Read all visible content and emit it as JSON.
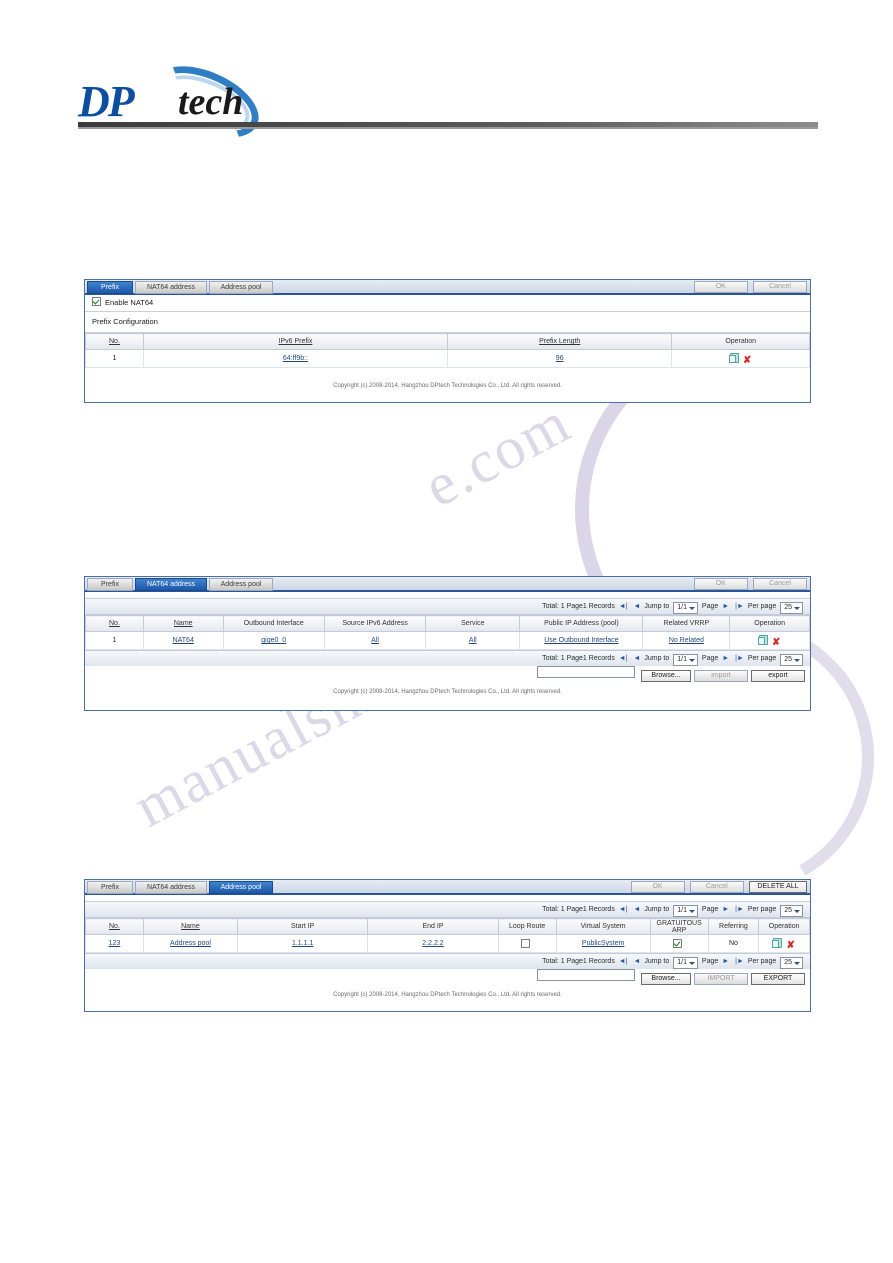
{
  "logo": {
    "brand_left": "DP",
    "brand_right": "tech"
  },
  "watermark": {
    "line1": "e.com",
    "line2": "manualshive"
  },
  "footer_text": "Copyright (c) 2008-2014, Hangzhou DPtech Technologies Co., Ltd. All rights reserved.",
  "tabs": {
    "prefix": "Prefix",
    "nat64_address": "NAT64 address",
    "address_pool": "Address pool"
  },
  "buttons": {
    "ok": "OK",
    "cancel": "Cancel",
    "delete_all": "DELETE ALL",
    "browse": "Browse...",
    "import_lower": "import",
    "export_lower": "export",
    "import_upper": "IMPORT",
    "export_upper": "EXPORT"
  },
  "pagination": {
    "total": "Total: 1 Page1 Records",
    "jump_label": "Jump to",
    "page_value": "1/1",
    "page_label": "Page",
    "per_page_label": "Per page",
    "per_page_value": "25",
    "first_icon": "first-page-icon",
    "prev_icon": "prev-page-icon",
    "next_icon": "next-page-icon",
    "last_icon": "last-page-icon"
  },
  "panel_prefix": {
    "enable_label": "Enable NAT64",
    "enable_checked": true,
    "section_title": "Prefix Configuration",
    "columns": [
      "No.",
      "IPv6 Prefix",
      "Prefix Length",
      "Operation"
    ],
    "rows": [
      {
        "no": "1",
        "ipv6_prefix": "64:ff9b::",
        "prefix_length": "96"
      }
    ]
  },
  "panel_nat64_address": {
    "columns": [
      "No.",
      "Name",
      "Outbound Interface",
      "Source IPv6 Address",
      "Service",
      "Public IP Address (pool)",
      "Related VRRP",
      "Operation"
    ],
    "rows": [
      {
        "no": "1",
        "name": "NAT64",
        "outbound_interface": "gige0_0",
        "source_ipv6_address": "All",
        "service": "All",
        "public_ip_address": "Use Outbound Interface",
        "related_vrrp": "No Related"
      }
    ]
  },
  "panel_address_pool": {
    "columns": [
      "No.",
      "Name",
      "Start IP",
      "End IP",
      "Loop Route",
      "Virtual System",
      "GRATUITOUS ARP",
      "Referring",
      "Operation"
    ],
    "rows": [
      {
        "no": "123",
        "name": "Address pool",
        "start_ip": "1.1.1.1",
        "end_ip": "2.2.2.2",
        "loop_route_checked": false,
        "virtual_system": "PublicSystem",
        "gratuitous_arp_checked": true,
        "referring": "No"
      }
    ]
  }
}
